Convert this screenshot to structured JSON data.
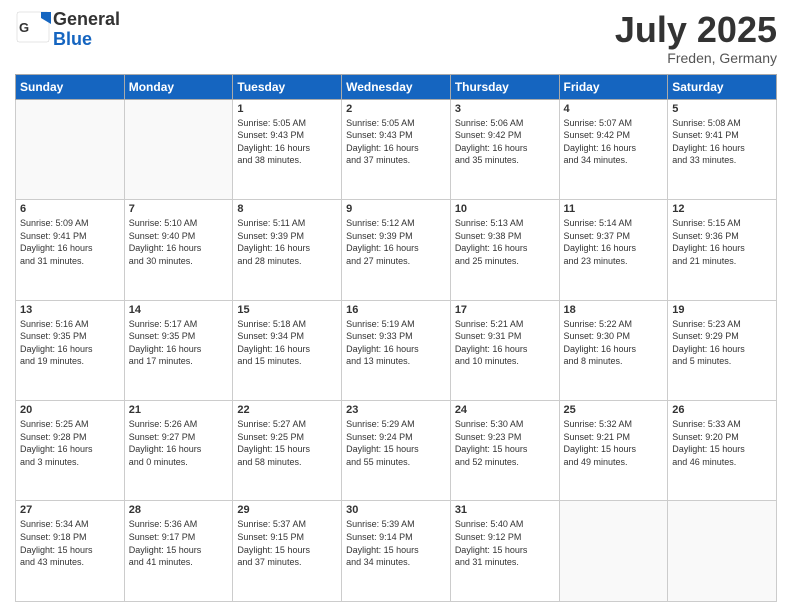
{
  "logo": {
    "general": "General",
    "blue": "Blue"
  },
  "title": "July 2025",
  "location": "Freden, Germany",
  "days_header": [
    "Sunday",
    "Monday",
    "Tuesday",
    "Wednesday",
    "Thursday",
    "Friday",
    "Saturday"
  ],
  "weeks": [
    [
      {
        "day": "",
        "info": ""
      },
      {
        "day": "",
        "info": ""
      },
      {
        "day": "1",
        "info": "Sunrise: 5:05 AM\nSunset: 9:43 PM\nDaylight: 16 hours\nand 38 minutes."
      },
      {
        "day": "2",
        "info": "Sunrise: 5:05 AM\nSunset: 9:43 PM\nDaylight: 16 hours\nand 37 minutes."
      },
      {
        "day": "3",
        "info": "Sunrise: 5:06 AM\nSunset: 9:42 PM\nDaylight: 16 hours\nand 35 minutes."
      },
      {
        "day": "4",
        "info": "Sunrise: 5:07 AM\nSunset: 9:42 PM\nDaylight: 16 hours\nand 34 minutes."
      },
      {
        "day": "5",
        "info": "Sunrise: 5:08 AM\nSunset: 9:41 PM\nDaylight: 16 hours\nand 33 minutes."
      }
    ],
    [
      {
        "day": "6",
        "info": "Sunrise: 5:09 AM\nSunset: 9:41 PM\nDaylight: 16 hours\nand 31 minutes."
      },
      {
        "day": "7",
        "info": "Sunrise: 5:10 AM\nSunset: 9:40 PM\nDaylight: 16 hours\nand 30 minutes."
      },
      {
        "day": "8",
        "info": "Sunrise: 5:11 AM\nSunset: 9:39 PM\nDaylight: 16 hours\nand 28 minutes."
      },
      {
        "day": "9",
        "info": "Sunrise: 5:12 AM\nSunset: 9:39 PM\nDaylight: 16 hours\nand 27 minutes."
      },
      {
        "day": "10",
        "info": "Sunrise: 5:13 AM\nSunset: 9:38 PM\nDaylight: 16 hours\nand 25 minutes."
      },
      {
        "day": "11",
        "info": "Sunrise: 5:14 AM\nSunset: 9:37 PM\nDaylight: 16 hours\nand 23 minutes."
      },
      {
        "day": "12",
        "info": "Sunrise: 5:15 AM\nSunset: 9:36 PM\nDaylight: 16 hours\nand 21 minutes."
      }
    ],
    [
      {
        "day": "13",
        "info": "Sunrise: 5:16 AM\nSunset: 9:35 PM\nDaylight: 16 hours\nand 19 minutes."
      },
      {
        "day": "14",
        "info": "Sunrise: 5:17 AM\nSunset: 9:35 PM\nDaylight: 16 hours\nand 17 minutes."
      },
      {
        "day": "15",
        "info": "Sunrise: 5:18 AM\nSunset: 9:34 PM\nDaylight: 16 hours\nand 15 minutes."
      },
      {
        "day": "16",
        "info": "Sunrise: 5:19 AM\nSunset: 9:33 PM\nDaylight: 16 hours\nand 13 minutes."
      },
      {
        "day": "17",
        "info": "Sunrise: 5:21 AM\nSunset: 9:31 PM\nDaylight: 16 hours\nand 10 minutes."
      },
      {
        "day": "18",
        "info": "Sunrise: 5:22 AM\nSunset: 9:30 PM\nDaylight: 16 hours\nand 8 minutes."
      },
      {
        "day": "19",
        "info": "Sunrise: 5:23 AM\nSunset: 9:29 PM\nDaylight: 16 hours\nand 5 minutes."
      }
    ],
    [
      {
        "day": "20",
        "info": "Sunrise: 5:25 AM\nSunset: 9:28 PM\nDaylight: 16 hours\nand 3 minutes."
      },
      {
        "day": "21",
        "info": "Sunrise: 5:26 AM\nSunset: 9:27 PM\nDaylight: 16 hours\nand 0 minutes."
      },
      {
        "day": "22",
        "info": "Sunrise: 5:27 AM\nSunset: 9:25 PM\nDaylight: 15 hours\nand 58 minutes."
      },
      {
        "day": "23",
        "info": "Sunrise: 5:29 AM\nSunset: 9:24 PM\nDaylight: 15 hours\nand 55 minutes."
      },
      {
        "day": "24",
        "info": "Sunrise: 5:30 AM\nSunset: 9:23 PM\nDaylight: 15 hours\nand 52 minutes."
      },
      {
        "day": "25",
        "info": "Sunrise: 5:32 AM\nSunset: 9:21 PM\nDaylight: 15 hours\nand 49 minutes."
      },
      {
        "day": "26",
        "info": "Sunrise: 5:33 AM\nSunset: 9:20 PM\nDaylight: 15 hours\nand 46 minutes."
      }
    ],
    [
      {
        "day": "27",
        "info": "Sunrise: 5:34 AM\nSunset: 9:18 PM\nDaylight: 15 hours\nand 43 minutes."
      },
      {
        "day": "28",
        "info": "Sunrise: 5:36 AM\nSunset: 9:17 PM\nDaylight: 15 hours\nand 41 minutes."
      },
      {
        "day": "29",
        "info": "Sunrise: 5:37 AM\nSunset: 9:15 PM\nDaylight: 15 hours\nand 37 minutes."
      },
      {
        "day": "30",
        "info": "Sunrise: 5:39 AM\nSunset: 9:14 PM\nDaylight: 15 hours\nand 34 minutes."
      },
      {
        "day": "31",
        "info": "Sunrise: 5:40 AM\nSunset: 9:12 PM\nDaylight: 15 hours\nand 31 minutes."
      },
      {
        "day": "",
        "info": ""
      },
      {
        "day": "",
        "info": ""
      }
    ]
  ]
}
